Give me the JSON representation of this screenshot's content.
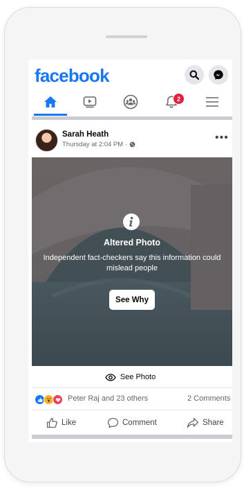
{
  "header": {
    "logo_text": "facebook",
    "accent": "#1877f2"
  },
  "tabs": [
    {
      "name": "home",
      "icon": "home-icon",
      "active": true
    },
    {
      "name": "watch",
      "icon": "video-icon",
      "active": false
    },
    {
      "name": "groups",
      "icon": "groups-icon",
      "active": false
    },
    {
      "name": "notifications",
      "icon": "bell-icon",
      "badge": "2",
      "active": false
    },
    {
      "name": "menu",
      "icon": "hamburger-menu-icon",
      "active": false
    }
  ],
  "post": {
    "author": "Sarah Heath",
    "time": "Thursday at 2:04 PM · ",
    "privacy_icon": "globe-icon",
    "warning": {
      "title": "Altered Photo",
      "description": "Independent fact-checkers say this information could mislead people",
      "button": "See Why"
    },
    "see_photo": "See Photo",
    "reactions_text": "Peter Raj and 23 others",
    "comments_text": "2 Comments",
    "actions": {
      "like": "Like",
      "comment": "Comment",
      "share": "Share"
    }
  }
}
